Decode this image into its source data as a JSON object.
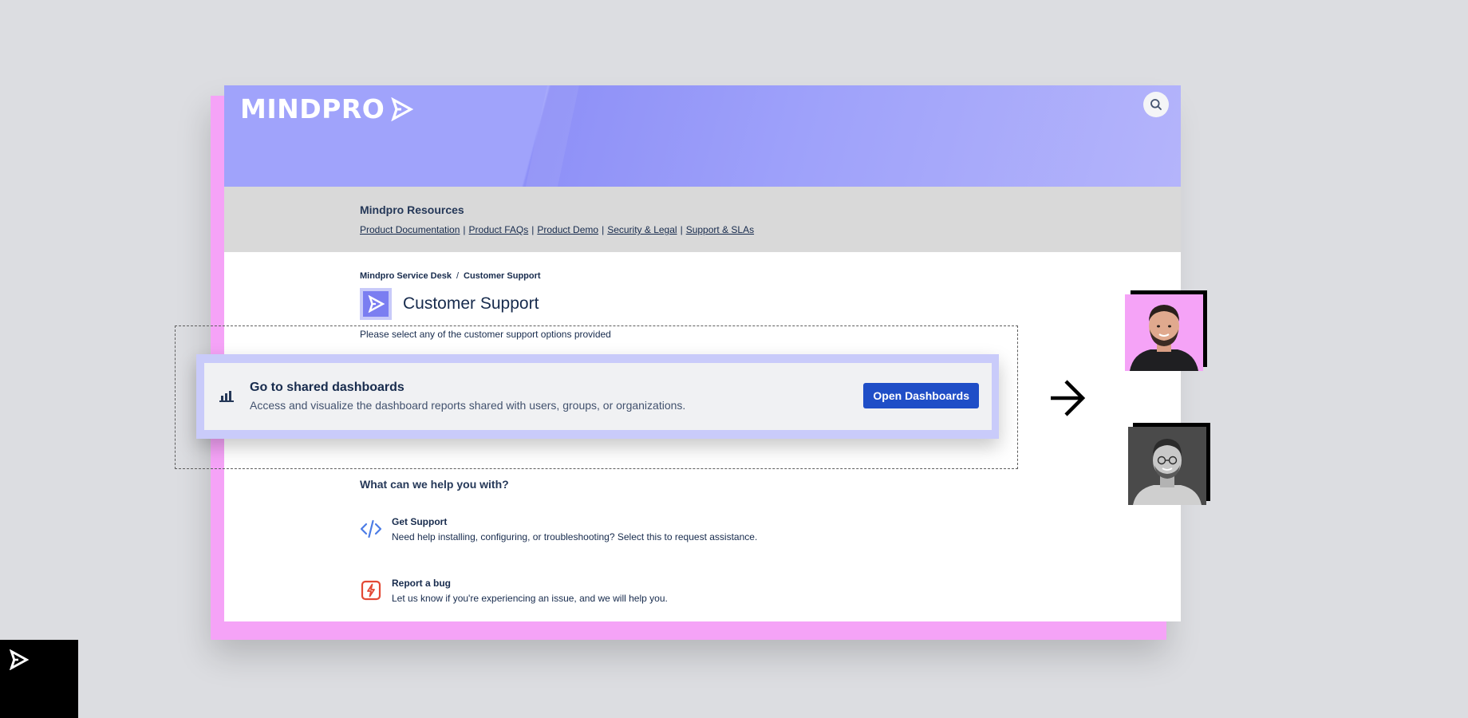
{
  "brand": {
    "name": "MINDPRO",
    "accent": "#8e90f7",
    "pink": "#f5a3f7",
    "button_blue": "#1f4ec7"
  },
  "header": {
    "search_icon": "search-icon"
  },
  "resources": {
    "title": "Mindpro Resources",
    "links": [
      "Product Documentation",
      "Product FAQs",
      "Product Demo",
      "Security & Legal",
      "Support & SLAs"
    ],
    "separator": "|"
  },
  "breadcrumb": {
    "items": [
      "Mindpro Service Desk",
      "Customer Support"
    ],
    "separator": "/"
  },
  "page": {
    "title": "Customer Support",
    "subtitle": "Please select any of the customer support options provided"
  },
  "dashboard_card": {
    "icon": "bar-chart-icon",
    "title": "Go to shared dashboards",
    "description": "Access and visualize the dashboard reports shared with users, groups, or organizations.",
    "button_label": "Open Dashboards"
  },
  "help": {
    "title": "What can we help you with?",
    "options": [
      {
        "icon": "code-icon",
        "name": "Get Support",
        "description": "Need help installing, configuring, or troubleshooting? Select this to request assistance."
      },
      {
        "icon": "lightning-bug-icon",
        "name": "Report a bug",
        "description": "Let us know if you're experiencing an issue, and we will help you."
      }
    ]
  }
}
